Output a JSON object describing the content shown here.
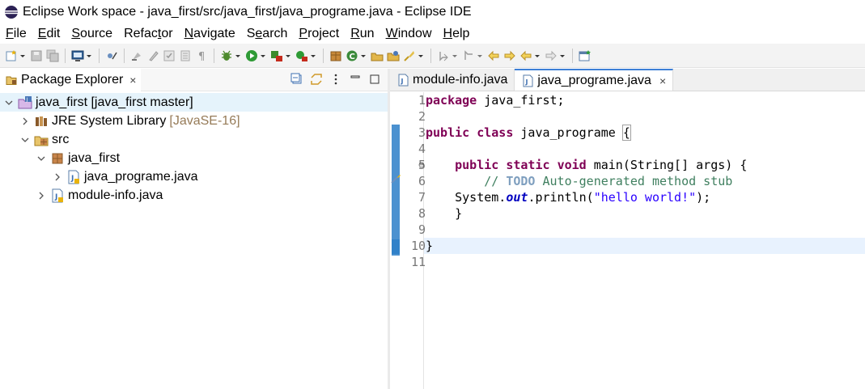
{
  "window": {
    "title": "Eclipse Work space - java_first/src/java_first/java_programe.java - Eclipse IDE"
  },
  "menu": [
    {
      "label": "File",
      "mnemonic_index": 0
    },
    {
      "label": "Edit",
      "mnemonic_index": 0
    },
    {
      "label": "Source",
      "mnemonic_index": 0
    },
    {
      "label": "Refactor",
      "mnemonic_index": 5
    },
    {
      "label": "Navigate",
      "mnemonic_index": 0
    },
    {
      "label": "Search",
      "mnemonic_index": 1
    },
    {
      "label": "Project",
      "mnemonic_index": 0
    },
    {
      "label": "Run",
      "mnemonic_index": 0
    },
    {
      "label": "Window",
      "mnemonic_index": 0
    },
    {
      "label": "Help",
      "mnemonic_index": 0
    }
  ],
  "package_explorer": {
    "title": "Package Explorer",
    "close": "×",
    "tree": [
      {
        "label": "java_first [java_first master]",
        "decoration": "",
        "expanded": true,
        "icon": "project-icon"
      },
      {
        "label": "JRE System Library",
        "decoration": "[JavaSE-16]",
        "expanded": false,
        "icon": "library-icon"
      },
      {
        "label": "src",
        "decoration": "",
        "expanded": true,
        "icon": "source-folder-icon"
      },
      {
        "label": "java_first",
        "decoration": "",
        "expanded": true,
        "icon": "package-icon"
      },
      {
        "label": "java_programe.java",
        "decoration": "",
        "expanded": false,
        "icon": "java-file-icon"
      },
      {
        "label": "module-info.java",
        "decoration": "",
        "expanded": false,
        "icon": "java-file-icon"
      }
    ]
  },
  "editor": {
    "tabs": [
      {
        "label": "module-info.java",
        "active": false
      },
      {
        "label": "java_programe.java",
        "active": true,
        "close": "×"
      }
    ],
    "line_numbers": [
      "1",
      "2",
      "3",
      "4",
      "5",
      "6",
      "7",
      "8",
      "9",
      "10",
      "11"
    ],
    "lines": [
      {
        "k1": "package",
        "t1": " java_first;"
      },
      {},
      {
        "k1": "public",
        "k2": "class",
        "t1": " java_programe ",
        "bracket": "{"
      },
      {},
      {
        "indent": "    ",
        "k1": "public",
        "k2": "static",
        "k3": "void",
        "t1": " main(String[] args) {"
      },
      {
        "indent": "        ",
        "c1": "// ",
        "todo": "TODO",
        "c2": " Auto-generated method stub"
      },
      {
        "indent": "    ",
        "t1": "System.",
        "field": "out",
        "t2": ".println(",
        "str": "\"hello world!\"",
        "t3": ");"
      },
      {
        "indent": "    ",
        "t1": "}"
      },
      {},
      {
        "t1": "}"
      },
      {}
    ],
    "fold_marker": "⊖",
    "current_line": 10
  }
}
